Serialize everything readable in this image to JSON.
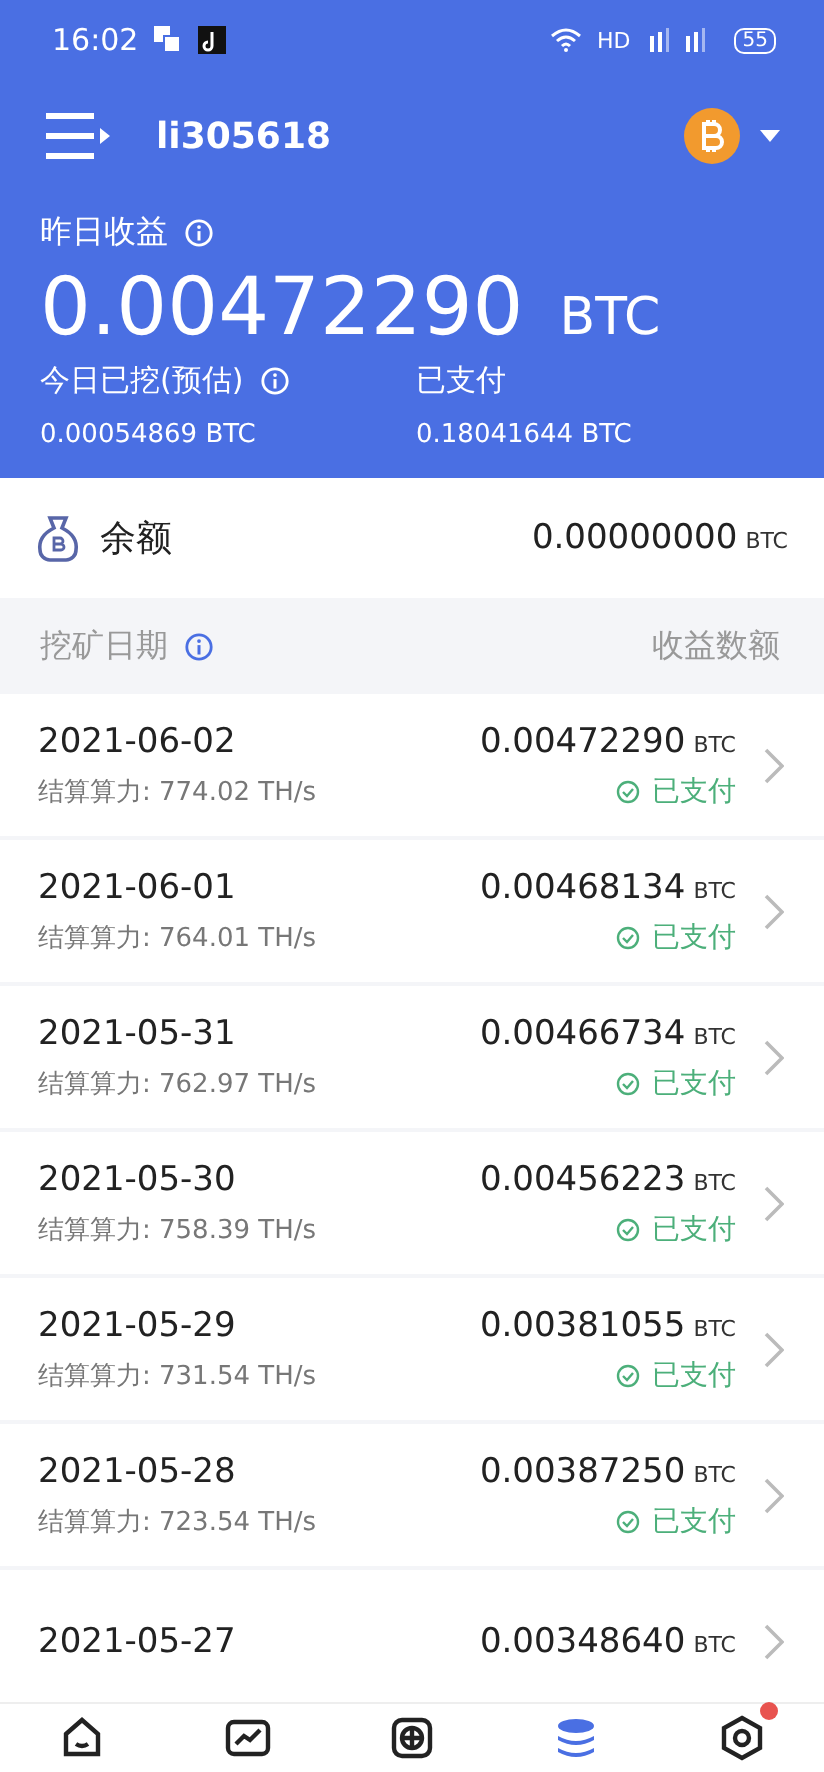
{
  "status_bar": {
    "time": "16:02",
    "network": "HD",
    "battery": "55"
  },
  "header": {
    "username": "li305618"
  },
  "summary": {
    "yesterday_label": "昨日收益",
    "yesterday_value": "0.00472290",
    "yesterday_unit": "BTC",
    "today_label": "今日已挖(预估)",
    "today_value": "0.00054869 BTC",
    "paid_label": "已支付",
    "paid_value": "0.18041644 BTC"
  },
  "balance": {
    "label": "余额",
    "value": "0.00000000",
    "unit": "BTC"
  },
  "table": {
    "columns": [
      "挖矿日期",
      "收益数额"
    ],
    "rows": [
      {
        "date": "2021-06-02",
        "hashrate": "结算算力: 774.02 TH/s",
        "amount": "0.00472290",
        "unit": "BTC",
        "status": "已支付"
      },
      {
        "date": "2021-06-01",
        "hashrate": "结算算力: 764.01 TH/s",
        "amount": "0.00468134",
        "unit": "BTC",
        "status": "已支付"
      },
      {
        "date": "2021-05-31",
        "hashrate": "结算算力: 762.97 TH/s",
        "amount": "0.00466734",
        "unit": "BTC",
        "status": "已支付"
      },
      {
        "date": "2021-05-30",
        "hashrate": "结算算力: 758.39 TH/s",
        "amount": "0.00456223",
        "unit": "BTC",
        "status": "已支付"
      },
      {
        "date": "2021-05-29",
        "hashrate": "结算算力: 731.54 TH/s",
        "amount": "0.00381055",
        "unit": "BTC",
        "status": "已支付"
      },
      {
        "date": "2021-05-28",
        "hashrate": "结算算力: 723.54 TH/s",
        "amount": "0.00387250",
        "unit": "BTC",
        "status": "已支付"
      },
      {
        "date": "2021-05-27",
        "amount": "0.00348640",
        "unit": "BTC"
      }
    ]
  },
  "nav": [
    {
      "kind": "home",
      "selected": false,
      "badge": false
    },
    {
      "kind": "chart",
      "selected": false,
      "badge": false
    },
    {
      "kind": "plus",
      "selected": false,
      "badge": false
    },
    {
      "kind": "coins",
      "selected": true,
      "badge": false
    },
    {
      "kind": "settings",
      "selected": false,
      "badge": true
    }
  ]
}
